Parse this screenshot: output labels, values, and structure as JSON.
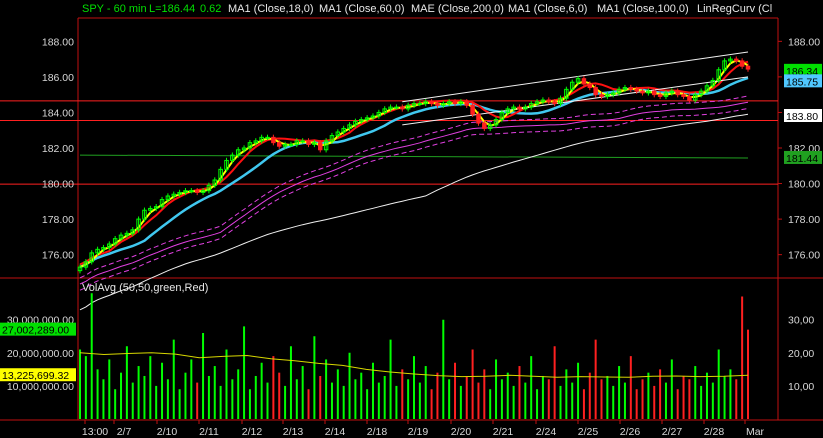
{
  "header": {
    "symbol": "SPY - 60 min",
    "last": "L=186.44",
    "change": "0.62",
    "studies": [
      "MA1 (Close,18,0)",
      "MA1 (Close,60,0)",
      "MAE (Close,200,0)",
      "MA1 (Close,6,0)",
      "MA1 (Close,100,0)",
      "LinRegCurv (Cl"
    ]
  },
  "volume_header": "VolAvg (50,50,green,Red)",
  "colors": {
    "up": "#00ff00",
    "down": "#ff2020",
    "ma18": "#ff1010",
    "ma6": "#ffff00",
    "ma60": "#40c8f0",
    "mae": "#e040e0",
    "ma100": "#f0f0f0",
    "linreg": "#f0f0f0",
    "volavg": "#d8d800",
    "level": "#ff2020",
    "green_line": "#20a020",
    "frame": "#c01010"
  },
  "price_tags": [
    {
      "label": "186.34",
      "value": 186.34,
      "bg": "#00e000"
    },
    {
      "label": "185.75",
      "value": 185.75,
      "bg": "#50c8ff"
    },
    {
      "label": "183.80",
      "value": 183.8,
      "bg": "#ffffff"
    },
    {
      "label": "181.44",
      "value": 181.44,
      "bg": "#20a020"
    }
  ],
  "volume_tags": [
    {
      "label": "27,002,289.00",
      "value": 27002289,
      "bg": "#00e000"
    },
    {
      "label": "13,225,699.32",
      "value": 13225699.32,
      "bg": "#ffff00"
    }
  ],
  "chart_data": {
    "type": "candlestick",
    "price_axis": {
      "ylim": [
        174.8,
        189.2
      ],
      "right_ticks": [
        "188.00",
        "186.00",
        "184.00",
        "182.00",
        "180.00",
        "178.00",
        "176.00"
      ],
      "right_tick_values": [
        188,
        186,
        184,
        182,
        180,
        178,
        176
      ],
      "left_ticks": [
        "188.00",
        "186.00",
        "184.00",
        "182.00",
        "180.00",
        "178.00",
        "176.00"
      ],
      "left_tick_values": [
        188,
        186,
        184,
        182,
        180,
        178,
        176
      ]
    },
    "horizontal_levels": [
      184.65,
      183.55,
      179.97
    ],
    "green_line": {
      "from": 181.6,
      "to": 181.44
    },
    "x_labels": [
      "13:00",
      "2/7",
      "2/10",
      "2/11",
      "2/12",
      "2/13",
      "2/14",
      "2/18",
      "2/19",
      "2/20",
      "2/21",
      "2/24",
      "2/25",
      "2/26",
      "2/27",
      "2/28",
      "Mar"
    ],
    "closes": [
      175.3,
      175.6,
      176.1,
      176.3,
      176.4,
      176.6,
      176.9,
      177.1,
      177.2,
      177.4,
      178.0,
      178.5,
      178.6,
      178.7,
      179.1,
      179.3,
      179.4,
      179.5,
      179.6,
      179.6,
      179.5,
      179.6,
      179.9,
      180.2,
      180.8,
      181.3,
      181.6,
      181.9,
      182.0,
      182.3,
      182.4,
      182.6,
      182.6,
      182.3,
      182.1,
      182.2,
      182.2,
      182.4,
      182.4,
      182.2,
      182.3,
      181.9,
      182.4,
      182.7,
      182.9,
      183.1,
      183.3,
      183.5,
      183.6,
      183.7,
      183.8,
      184.0,
      184.2,
      184.3,
      184.3,
      184.2,
      184.4,
      184.5,
      184.5,
      184.6,
      184.5,
      184.4,
      184.5,
      184.6,
      184.5,
      184.6,
      184.4,
      183.9,
      183.4,
      183.1,
      183.3,
      183.6,
      184.0,
      184.2,
      184.3,
      184.2,
      184.3,
      184.5,
      184.6,
      184.7,
      184.6,
      184.5,
      184.8,
      185.3,
      185.7,
      185.9,
      185.6,
      185.4,
      185.0,
      184.9,
      185.0,
      185.1,
      185.3,
      185.4,
      185.3,
      185.2,
      185.1,
      185.2,
      185.0,
      184.9,
      185.1,
      185.2,
      185.0,
      184.9,
      184.7,
      185.0,
      185.2,
      185.5,
      185.8,
      186.4,
      186.9,
      187.0,
      186.9,
      186.6,
      186.44
    ],
    "volume_axis": {
      "ylim": [
        0,
        42000000
      ],
      "left_ticks": [
        "30,000,000.00",
        "20,000,000.00",
        "10,000,000.00"
      ],
      "right_ticks": [
        "30,00",
        "20,00",
        "10,00"
      ],
      "tick_values": [
        30000000,
        20000000,
        10000000
      ]
    },
    "volumes": [
      21,
      19,
      38,
      15,
      12,
      18,
      9,
      14,
      22,
      11,
      16,
      13,
      19,
      10,
      17,
      12,
      24,
      9,
      14,
      18,
      11,
      26,
      13,
      16,
      10,
      21,
      12,
      15,
      28,
      9,
      13,
      17,
      11,
      19,
      14,
      10,
      22,
      12,
      16,
      9,
      25,
      13,
      18,
      11,
      15,
      10,
      20,
      12,
      14,
      9,
      17,
      11,
      13,
      24,
      10,
      15,
      12,
      19,
      11,
      16,
      9,
      14,
      30,
      12,
      17,
      10,
      13,
      21,
      11,
      15,
      9,
      18,
      12,
      14,
      10,
      16,
      11,
      19,
      9,
      13,
      12,
      22,
      10,
      15,
      11,
      17,
      9,
      14,
      24,
      12,
      13,
      10,
      16,
      11,
      19,
      9,
      12,
      14,
      10,
      15,
      11,
      18,
      9,
      13,
      12,
      16,
      10,
      14,
      11,
      21,
      13,
      15,
      12,
      37,
      27
    ],
    "volume_avg": [
      20,
      19.5,
      19.8,
      20,
      19.6,
      18.5,
      18.9,
      19.2,
      18.2,
      17.6,
      16.8,
      16.2,
      15,
      14.2,
      13.6,
      13.1,
      12.8,
      12.9,
      13.2,
      12.9,
      12.6,
      12.8,
      12.7,
      12.6,
      12.9,
      13.0,
      12.8,
      12.9,
      13.2
    ]
  }
}
